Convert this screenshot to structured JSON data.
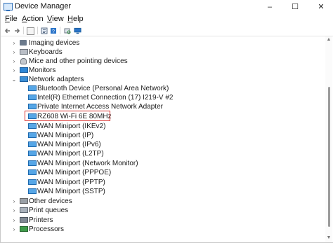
{
  "window": {
    "title": "Device Manager",
    "controls": {
      "minimize": "–",
      "maximize": "☐",
      "close": "✕"
    }
  },
  "menubar": [
    {
      "prefix": "",
      "accel": "F",
      "rest": "ile"
    },
    {
      "prefix": "",
      "accel": "A",
      "rest": "ction"
    },
    {
      "prefix": "",
      "accel": "V",
      "rest": "iew"
    },
    {
      "prefix": "",
      "accel": "H",
      "rest": "elp"
    }
  ],
  "toolbar": {
    "icons": [
      "back-icon",
      "forward-icon",
      "show-hide-console-tree-icon",
      "properties-icon",
      "help-icon",
      "scan-for-hardware-changes-icon",
      "view-devices-icon"
    ]
  },
  "tree": {
    "imaging": "Imaging devices",
    "keyboards": "Keyboards",
    "mice": "Mice and other pointing devices",
    "monitors": "Monitors",
    "network": "Network adapters",
    "adapters": [
      "Bluetooth Device (Personal Area Network)",
      "Intel(R) Ethernet Connection (17) I219-V #2",
      "Private Internet Access Network Adapter",
      "RZ608 Wi-Fi 6E 80MHz",
      "WAN Miniport (IKEv2)",
      "WAN Miniport (IP)",
      "WAN Miniport (IPv6)",
      "WAN Miniport (L2TP)",
      "WAN Miniport (Network Monitor)",
      "WAN Miniport (PPPOE)",
      "WAN Miniport (PPTP)",
      "WAN Miniport (SSTP)"
    ],
    "other": "Other devices",
    "printq": "Print queues",
    "printers": "Printers",
    "processors": "Processors"
  },
  "glyphs": {
    "collapsed": "›",
    "expanded": "⌄",
    "scroll_up": "▲",
    "scroll_down": "▼"
  },
  "colors": {
    "highlight_border": "#d9302c",
    "accent": "#2a74c9"
  }
}
